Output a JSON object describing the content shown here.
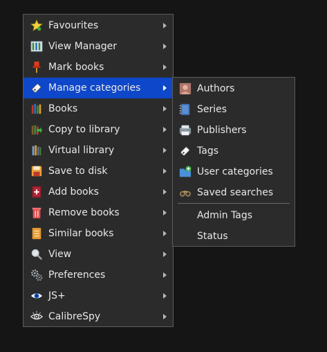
{
  "main_menu": {
    "items": [
      {
        "label": "Favourites",
        "icon": "star-icon"
      },
      {
        "label": "View Manager",
        "icon": "view-manager-icon"
      },
      {
        "label": "Mark books",
        "icon": "pushpin-icon"
      },
      {
        "label": "Manage categories",
        "icon": "tag-icon"
      },
      {
        "label": "Books",
        "icon": "books-icon"
      },
      {
        "label": "Copy to library",
        "icon": "copy-library-icon"
      },
      {
        "label": "Virtual library",
        "icon": "virtual-library-icon"
      },
      {
        "label": "Save to disk",
        "icon": "save-disk-icon"
      },
      {
        "label": "Add books",
        "icon": "add-books-icon"
      },
      {
        "label": "Remove books",
        "icon": "remove-books-icon"
      },
      {
        "label": "Similar books",
        "icon": "similar-books-icon"
      },
      {
        "label": "View",
        "icon": "magnifier-icon"
      },
      {
        "label": "Preferences",
        "icon": "gears-icon"
      },
      {
        "label": "JS+",
        "icon": "eye-icon"
      },
      {
        "label": "CalibreSpy",
        "icon": "spy-eye-icon"
      }
    ]
  },
  "sub_menu": {
    "items": [
      {
        "label": "Authors",
        "icon": "authors-icon"
      },
      {
        "label": "Series",
        "icon": "series-icon"
      },
      {
        "label": "Publishers",
        "icon": "publishers-icon"
      },
      {
        "label": "Tags",
        "icon": "tag-icon"
      },
      {
        "label": "User categories",
        "icon": "user-categories-icon"
      },
      {
        "label": "Saved searches",
        "icon": "saved-searches-icon"
      }
    ],
    "extra_items": [
      {
        "label": "Admin Tags"
      },
      {
        "label": "Status"
      }
    ]
  },
  "colors": {
    "background": "#151515",
    "menu_background": "#2b2b2b",
    "highlight": "#0e47c9",
    "text": "#e8e8e8"
  }
}
